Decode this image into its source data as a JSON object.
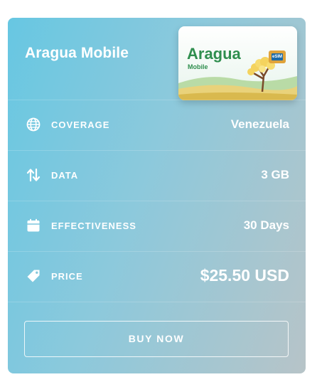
{
  "plan": {
    "title": "Aragua Mobile",
    "sim_card": {
      "brand": "Aragua",
      "subtitle": "Mobile",
      "chip_text": "eSIM"
    },
    "details": [
      {
        "icon": "globe-icon",
        "label": "COVERAGE",
        "value": "Venezuela"
      },
      {
        "icon": "arrows-up-down-icon",
        "label": "DATA",
        "value": "3 GB"
      },
      {
        "icon": "calendar-icon",
        "label": "EFFECTIVENESS",
        "value": "30 Days"
      },
      {
        "icon": "price-tag-icon",
        "label": "PRICE",
        "value": "$25.50 USD"
      }
    ],
    "buy_label": "BUY NOW"
  },
  "colors": {
    "gradient_start": "#67c7e2",
    "gradient_end": "#b7c4c8",
    "brand_green": "#2f8e4e"
  }
}
